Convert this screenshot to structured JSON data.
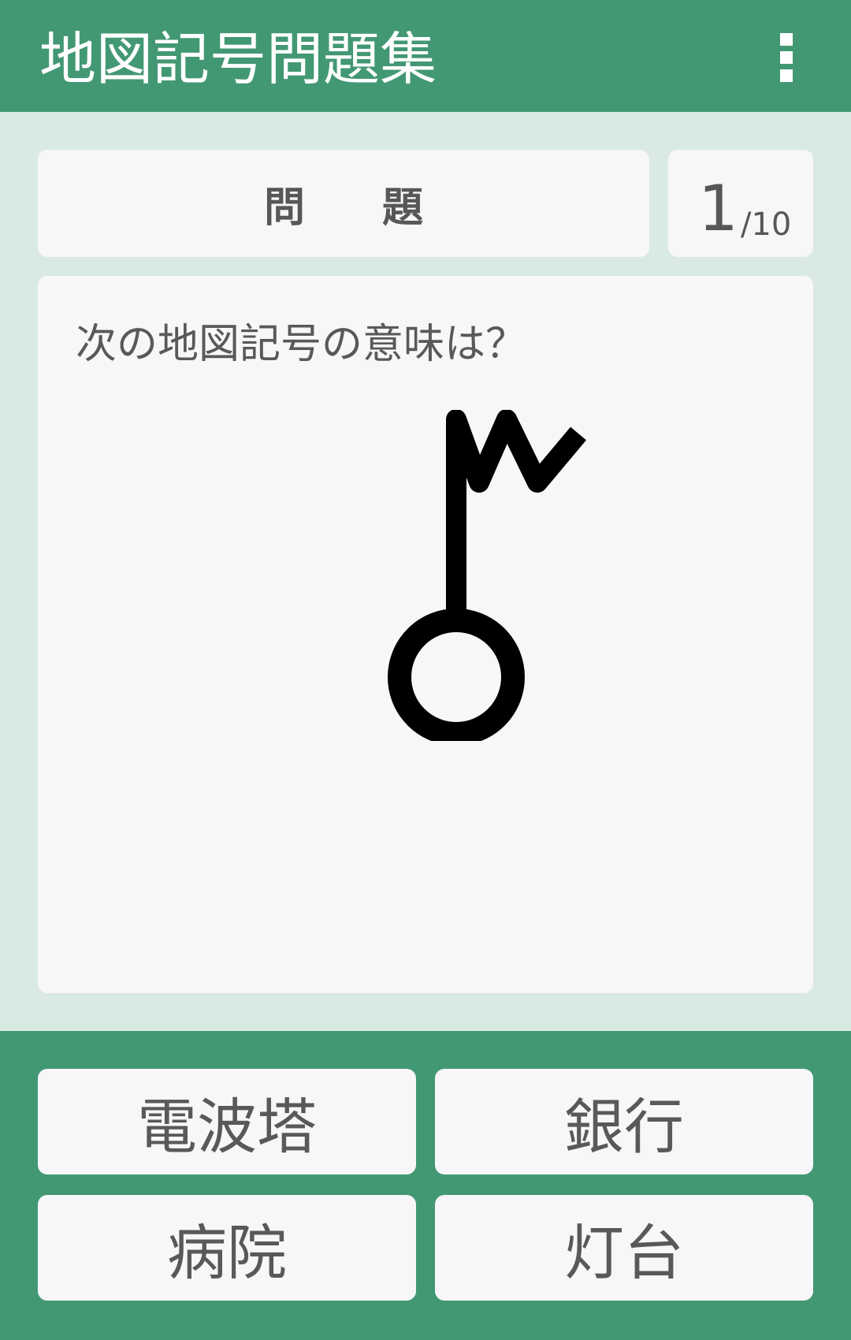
{
  "app_bar": {
    "title": "地図記号問題集",
    "menu_icon": "more-vert-icon"
  },
  "header": {
    "label": "問 題",
    "progress_current": "1",
    "progress_total": "/10"
  },
  "question": {
    "prompt": "次の地図記号の意味は？",
    "symbol_icon": "radio-tower-map-symbol"
  },
  "answers": [
    {
      "label": "電波塔"
    },
    {
      "label": "銀行"
    },
    {
      "label": "病院"
    },
    {
      "label": "灯台"
    }
  ],
  "colors": {
    "primary": "#439874",
    "background": "#d9eae3",
    "card": "#f7f6f9",
    "text": "#575757"
  }
}
